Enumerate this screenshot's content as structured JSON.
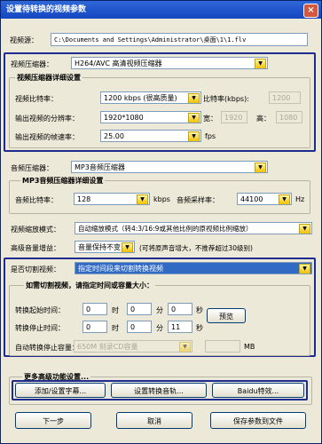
{
  "window": {
    "title": "设置待转换的视频参数",
    "close": "×"
  },
  "source": {
    "label": "视频源：",
    "path": "C:\\Documents and Settings\\Administrator\\桌面\\1\\1.flv"
  },
  "video": {
    "codec_label": "视频压缩器：",
    "codec_value": "H264/AVC 高清视频压缩器",
    "detail_title": "视频压缩器详细设置",
    "bitrate_label": "视频比特率：",
    "bitrate_value": "1200 kbps (很高质量)",
    "bitrate_label2": "比特率(kbps):",
    "bitrate_custom": "1200",
    "resolution_label": "输出视频的分辨率：",
    "resolution_value": "1920*1080",
    "width_label": "宽：",
    "width_value": "1920",
    "height_label": "高：",
    "height_value": "1080",
    "fps_label": "输出视频的帧速率：",
    "fps_value": "25.00",
    "fps_unit": "fps"
  },
  "audio": {
    "codec_label": "音频压缩器：",
    "codec_value": "MP3音频压缩器",
    "detail_title": "MP3音频压缩器详细设置",
    "bitrate_label": "音频比特率：",
    "bitrate_value": "128",
    "bitrate_unit": "kbps",
    "samplerate_label": "音频采样率：",
    "samplerate_value": "44100",
    "samplerate_unit": "Hz"
  },
  "scale": {
    "label": "视频缩放模式：",
    "value": "自动缩放模式（转4:3/16:9或其他比例的原视频比例缩放）"
  },
  "volume": {
    "label": "高级音量增益：",
    "value": "音量保持不变",
    "hint": "(可将原声音增大，不推荐超过30级别)"
  },
  "cut": {
    "label": "是否切割视频：",
    "value": "指定时间段来切割转换视频",
    "detail_title": "如需切割视频，请指定时间或容量大小：",
    "start_label": "转换起始时间：",
    "stop_label": "转换停止时间：",
    "start": {
      "h": "0",
      "m": "0",
      "s": "0"
    },
    "stop": {
      "h": "0",
      "m": "0",
      "s": "11"
    },
    "unit_h": "时",
    "unit_m": "分",
    "unit_s": "秒",
    "preview": "预览",
    "size_label": "自动转换停止容量：",
    "size_value": "650M 刻录CD容量",
    "size_unit": "MB"
  },
  "advanced": {
    "title": "更多高级功能设置...",
    "subtitle_btn": "添加/设置字幕...",
    "effect_btn": "设置转换音轨...",
    "special_btn": "Baidu特效..."
  },
  "footer": {
    "next": "下一步",
    "cancel": "取消",
    "save": "保存参数到文件"
  },
  "colors": {
    "titlebar": "#1446c0",
    "highlight_border": "#1f2b8f",
    "selection": "#316ac5",
    "dropdown": "#f0c000"
  }
}
